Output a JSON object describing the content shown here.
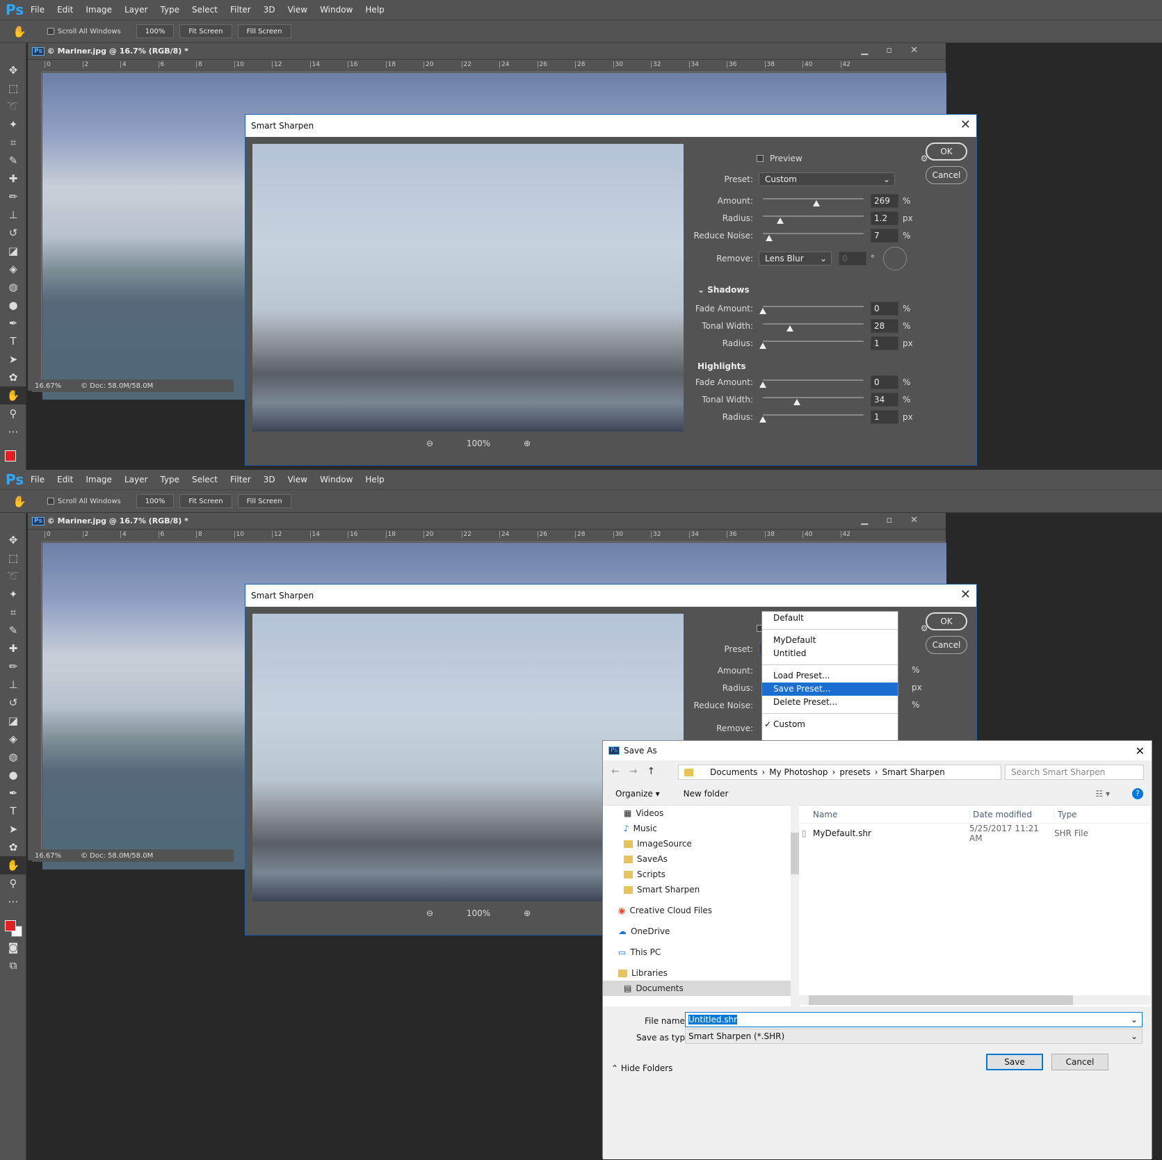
{
  "app": {
    "logo": "Ps",
    "menu": [
      "File",
      "Edit",
      "Image",
      "Layer",
      "Type",
      "Select",
      "Filter",
      "3D",
      "View",
      "Window",
      "Help"
    ]
  },
  "options": {
    "scroll_all": "Scroll All Windows",
    "zoom_btn": "100%",
    "fit_btn": "Fit Screen",
    "fill_btn": "Fill Screen"
  },
  "doc": {
    "title": "© Mariner.jpg @ 16.7% (RGB/8) *",
    "zoom": "16.67%",
    "docsize": "© Doc: 58.0M/58.0M",
    "ruler_h": [
      "0",
      "2",
      "4",
      "6",
      "8",
      "10",
      "12",
      "14",
      "16",
      "18",
      "20",
      "22",
      "24",
      "26",
      "28",
      "30",
      "32",
      "34",
      "36",
      "38",
      "40",
      "42"
    ],
    "ruler_v": [
      "0",
      "2",
      "4",
      "6",
      "8",
      "1 0",
      "1 2",
      "1 4"
    ]
  },
  "dialog": {
    "title": "Smart Sharpen",
    "preview_label": "Preview",
    "ok": "OK",
    "cancel": "Cancel",
    "preview_zoom": "100%",
    "preset_label": "Preset:",
    "preset_value": "Custom",
    "amount_label": "Amount:",
    "amount": "269",
    "radius_label": "Radius:",
    "radius": "1.2",
    "noise_label": "Reduce Noise:",
    "noise": "7",
    "remove_label": "Remove:",
    "remove_value": "Lens Blur",
    "angle": "0",
    "shadows": "Shadows",
    "highlights": "Highlights",
    "fade_label": "Fade Amount:",
    "tonal_label": "Tonal Width:",
    "sh_fade": "0",
    "sh_tonal": "28",
    "sh_radius": "1",
    "hl_fade": "0",
    "hl_tonal": "34",
    "hl_radius": "1",
    "pct": "%",
    "px": "px",
    "deg": "°"
  },
  "slider_levels": {
    "amount": 0.53,
    "radius": 0.17,
    "noise": 0.06,
    "sh_fade": 0.0,
    "sh_tonal": 0.27,
    "sh_radius": 0.0,
    "hl_fade": 0.0,
    "hl_tonal": 0.34,
    "hl_radius": 0.0
  },
  "preset_menu": [
    "Default",
    "MyDefault",
    "Untitled",
    "Load Preset...",
    "Save Preset...",
    "Delete Preset...",
    "Custom"
  ],
  "saveas": {
    "title": "Save As",
    "path": [
      "Documents",
      "My Photoshop",
      "presets",
      "Smart Sharpen"
    ],
    "search": "Search Smart Sharpen",
    "organize": "Organize ▾",
    "newfolder": "New folder",
    "nav": [
      "Videos",
      "Music",
      "ImageSource",
      "SaveAs",
      "Scripts",
      "Smart Sharpen",
      "Creative Cloud Files",
      "OneDrive",
      "This PC",
      "Libraries",
      "Documents"
    ],
    "col_name": "Name",
    "col_date": "Date modified",
    "col_type": "Type",
    "file_name": "MyDefault.shr",
    "file_date": "5/25/2017 11:21 AM",
    "file_type": "SHR File",
    "fn_label": "File name:",
    "fn_value": "Untitled.shr",
    "type_label": "Save as type:",
    "type_value": "Smart Sharpen (*.SHR)",
    "hide": "Hide Folders",
    "save": "Save",
    "cancel": "Cancel"
  },
  "colors": {
    "ps_blue": "#31a8ff",
    "fg_color": "#e02020",
    "select_blue": "#1a6fd1"
  }
}
